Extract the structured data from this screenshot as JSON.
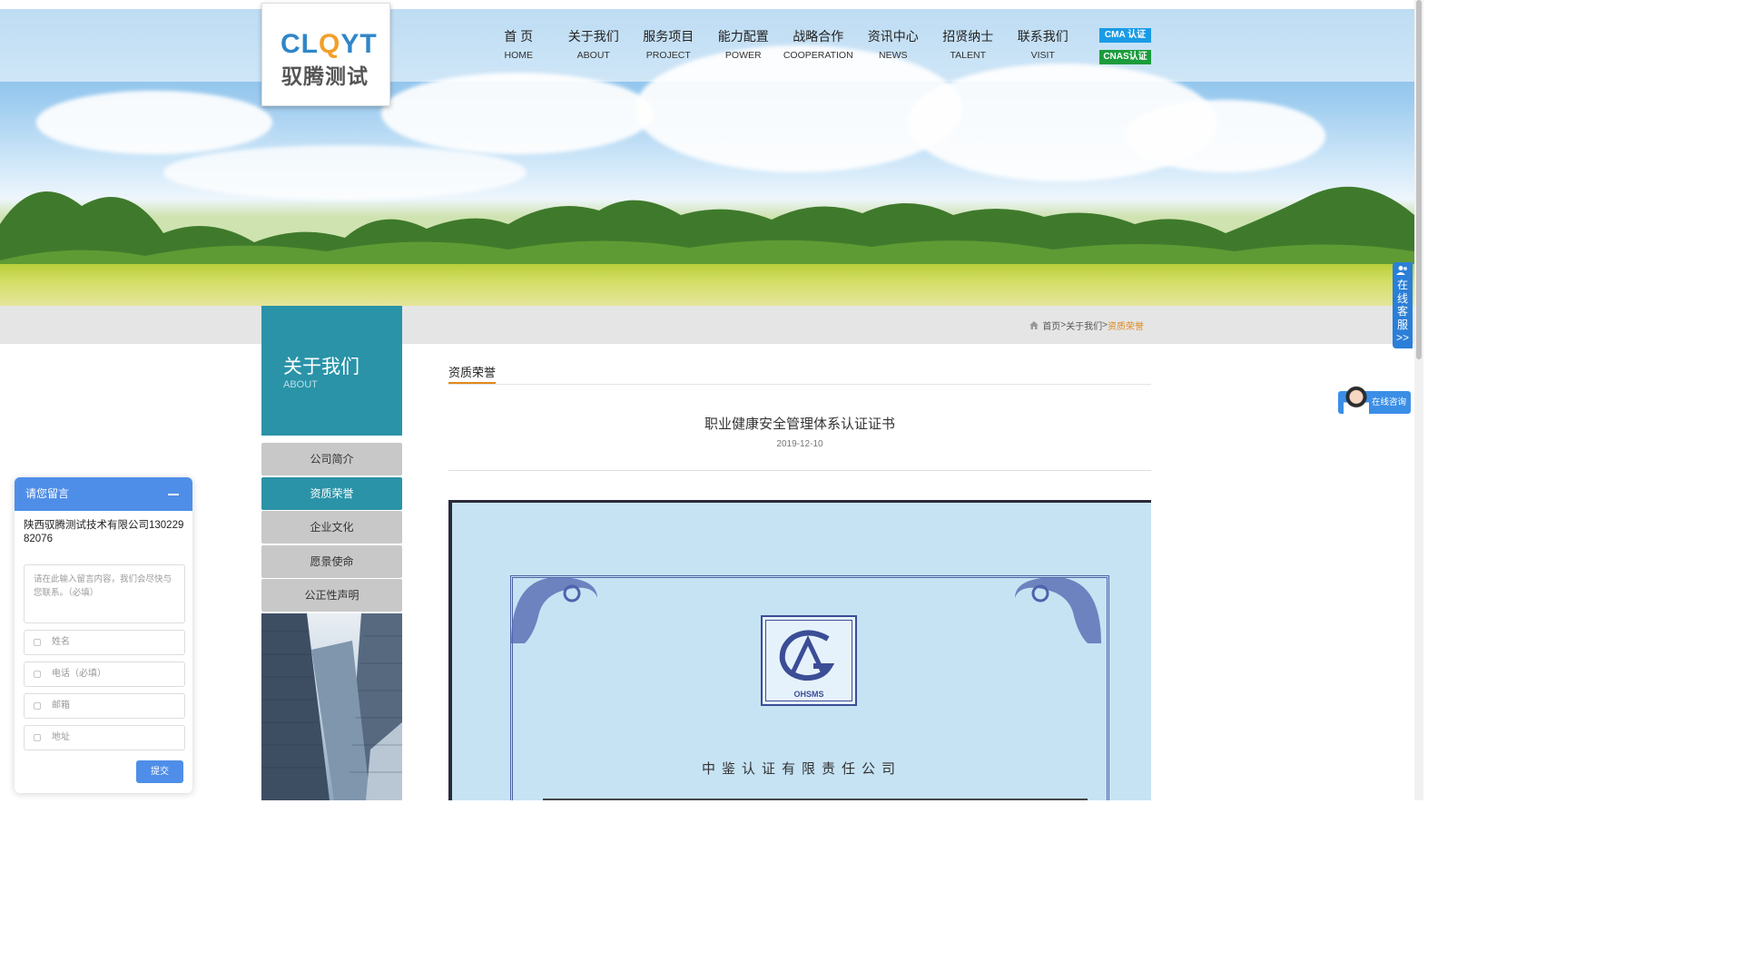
{
  "logo": {
    "en_main": "CL",
    "en_q": "Q",
    "en_tail": "YT",
    "cn": "驭腾测试"
  },
  "nav": [
    {
      "cn": "首 页",
      "en": "HOME"
    },
    {
      "cn": "关于我们",
      "en": "ABOUT"
    },
    {
      "cn": "服务项目",
      "en": "PROJECT"
    },
    {
      "cn": "能力配置",
      "en": "POWER"
    },
    {
      "cn": "战略合作",
      "en": "COOPERATION"
    },
    {
      "cn": "资讯中心",
      "en": "NEWS"
    },
    {
      "cn": "招贤纳士",
      "en": "TALENT"
    },
    {
      "cn": "联系我们",
      "en": "VISIT"
    }
  ],
  "badges": {
    "cma": "CMA 认证",
    "cnas": "CNAS认证"
  },
  "breadcrumb": {
    "home": "首页",
    "sep": ">",
    "about": "关于我们",
    "current": "资质荣誉"
  },
  "sidebar": {
    "title": "关于我们",
    "subtitle": "ABOUT",
    "items": [
      "公司简介",
      "资质荣誉",
      "企业文化",
      "愿景使命",
      "公正性声明"
    ],
    "active_index": 1
  },
  "content": {
    "section_title": "资质荣誉",
    "article_title": "职业健康安全管理体系认证证书",
    "article_date": "2019-12-10",
    "cert_logo_text": "OHSMS",
    "cert_org": "中鉴认证有限责任公司"
  },
  "float": {
    "kefu_chars": [
      "在",
      "线",
      "客",
      "服"
    ],
    "kefu_arrow": ">>",
    "consult": "在线咨询"
  },
  "message_widget": {
    "title": "请您留言",
    "company": "陕西驭腾测试技术有限公司13022982076",
    "textarea_placeholder": "请在此输入留言内容，我们会尽快与您联系。（必填）",
    "name_placeholder": "姓名",
    "phone_placeholder": "电话（必填）",
    "email_placeholder": "邮箱",
    "address_placeholder": "地址",
    "submit": "提交"
  },
  "colors": {
    "teal": "#2a93a8",
    "orange": "#e08a18",
    "blue": "#4f8ee8",
    "cma": "#1a9be6",
    "cnas": "#1b9c3c"
  }
}
